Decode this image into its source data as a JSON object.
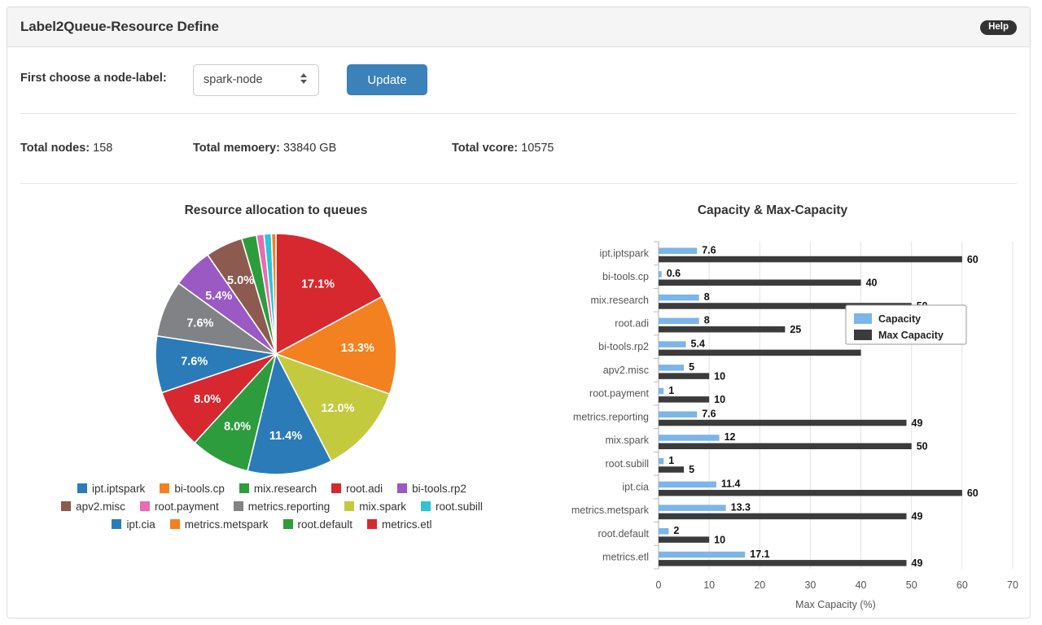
{
  "header": {
    "title": "Label2Queue-Resource Define",
    "help_label": "Help"
  },
  "controls": {
    "node_label_label": "First choose a node-label:",
    "node_label_value": "spark-node",
    "update_label": "Update"
  },
  "totals": [
    {
      "label": "Total nodes:",
      "value": "158"
    },
    {
      "label": "Total memoery:",
      "value": "33840 GB"
    },
    {
      "label": "Total vcore:",
      "value": "10575"
    }
  ],
  "colors": {
    "accent_blue": "#3b82ba",
    "capacity_blue": "#7cb5e8",
    "max_capacity_dark": "#3b3b3b",
    "help_dark": "#333333"
  },
  "chart_data": [
    {
      "type": "pie",
      "title": "Resource allocation to queues",
      "legend_position": "bottom",
      "categories": [
        "ipt.iptspark",
        "bi-tools.cp",
        "mix.research",
        "root.adi",
        "bi-tools.rp2",
        "apv2.misc",
        "root.payment",
        "metrics.reporting",
        "mix.spark",
        "root.subill",
        "ipt.cia",
        "metrics.metspark",
        "root.default",
        "metrics.etl"
      ],
      "colors": [
        "#2b7bb9",
        "#f4811f",
        "#2d9c3c",
        "#d7282f",
        "#9b59c4",
        "#8c5a4e",
        "#e96bb3",
        "#808285",
        "#c3ca3e",
        "#2ec4d6",
        "#2b7bb9",
        "#f4811f",
        "#2d9c3c",
        "#d7282f"
      ],
      "values": [
        7.6,
        0.6,
        8.0,
        8.0,
        5.4,
        5.0,
        1.0,
        7.6,
        12.0,
        1.0,
        11.4,
        13.3,
        2.0,
        17.1
      ],
      "slice_order_clockwise_from_top": [
        {
          "name": "metrics.etl",
          "value": 17.1,
          "label": "17.1%",
          "color": "#d7282f",
          "show_label": true
        },
        {
          "name": "metrics.metspark",
          "value": 13.3,
          "label": "13.3%",
          "color": "#f4811f",
          "show_label": true
        },
        {
          "name": "mix.spark",
          "value": 12.0,
          "label": "12.0%",
          "color": "#c3ca3e",
          "show_label": true
        },
        {
          "name": "ipt.cia",
          "value": 11.4,
          "label": "11.4%",
          "color": "#2b7bb9",
          "show_label": true
        },
        {
          "name": "mix.research",
          "value": 8.0,
          "label": "8.0%",
          "color": "#2d9c3c",
          "show_label": true
        },
        {
          "name": "root.adi",
          "value": 8.0,
          "label": "8.0%",
          "color": "#d7282f",
          "show_label": true
        },
        {
          "name": "ipt.iptspark",
          "value": 7.6,
          "label": "7.6%",
          "color": "#2b7bb9",
          "show_label": true
        },
        {
          "name": "metrics.reporting",
          "value": 7.6,
          "label": "7.6%",
          "color": "#808285",
          "show_label": true
        },
        {
          "name": "bi-tools.rp2",
          "value": 5.4,
          "label": "5.4%",
          "color": "#9b59c4",
          "show_label": true
        },
        {
          "name": "apv2.misc",
          "value": 5.0,
          "label": "5.0%",
          "color": "#8c5a4e",
          "show_label": true
        },
        {
          "name": "root.default",
          "value": 2.0,
          "label": "2.0%",
          "color": "#2d9c3c",
          "show_label": false
        },
        {
          "name": "root.payment",
          "value": 1.0,
          "label": "1.0%",
          "color": "#e96bb3",
          "show_label": false
        },
        {
          "name": "root.subill",
          "value": 1.0,
          "label": "1.0%",
          "color": "#2ec4d6",
          "show_label": false
        },
        {
          "name": "bi-tools.cp",
          "value": 0.6,
          "label": "0.6%",
          "color": "#f4811f",
          "show_label": false
        }
      ],
      "legend_rows": [
        [
          {
            "label": "ipt.iptspark",
            "color": "#2b7bb9"
          },
          {
            "label": "bi-tools.cp",
            "color": "#f4811f"
          },
          {
            "label": "mix.research",
            "color": "#2d9c3c"
          },
          {
            "label": "root.adi",
            "color": "#d7282f"
          },
          {
            "label": "bi-tools.rp2",
            "color": "#9b59c4"
          }
        ],
        [
          {
            "label": "apv2.misc",
            "color": "#8c5a4e"
          },
          {
            "label": "root.payment",
            "color": "#e96bb3"
          },
          {
            "label": "metrics.reporting",
            "color": "#808285"
          },
          {
            "label": "mix.spark",
            "color": "#c3ca3e"
          },
          {
            "label": "root.subill",
            "color": "#2ec4d6"
          }
        ],
        [
          {
            "label": "ipt.cia",
            "color": "#2b7bb9"
          },
          {
            "label": "metrics.metspark",
            "color": "#f4811f"
          },
          {
            "label": "root.default",
            "color": "#2d9c3c"
          },
          {
            "label": "metrics.etl",
            "color": "#d7282f"
          }
        ]
      ]
    },
    {
      "type": "bar",
      "orientation": "horizontal",
      "title": "Capacity & Max-Capacity",
      "xlabel": "Max Capacity (%)",
      "ylabel": "",
      "xlim": [
        0,
        70
      ],
      "xticks": [
        0,
        10,
        20,
        30,
        40,
        50,
        60,
        70
      ],
      "grid": true,
      "legend_position": "right-inside",
      "categories": [
        "ipt.iptspark",
        "bi-tools.cp",
        "mix.research",
        "root.adi",
        "bi-tools.rp2",
        "apv2.misc",
        "root.payment",
        "metrics.reporting",
        "mix.spark",
        "root.subill",
        "ipt.cia",
        "metrics.metspark",
        "root.default",
        "metrics.etl"
      ],
      "series": [
        {
          "name": "Capacity",
          "color": "#7cb5e8",
          "values": [
            7.6,
            0.6,
            8,
            8,
            5.4,
            5,
            1,
            7.6,
            12,
            1,
            11.4,
            13.3,
            2,
            17.1
          ],
          "labels": [
            "7.6",
            "0.6",
            "8",
            "8",
            "5.4",
            "5",
            "1",
            "7.6",
            "12",
            "1",
            "11.4",
            "13.3",
            "2",
            "17.1"
          ]
        },
        {
          "name": "Max Capacity",
          "color": "#3b3b3b",
          "values": [
            60,
            40,
            50,
            25,
            40,
            10,
            10,
            49,
            50,
            5,
            60,
            49,
            10,
            49
          ],
          "labels": [
            "60",
            "40",
            "50",
            "25",
            "",
            "10",
            "10",
            "49",
            "50",
            "5",
            "60",
            "49",
            "10",
            "49"
          ]
        }
      ]
    }
  ]
}
